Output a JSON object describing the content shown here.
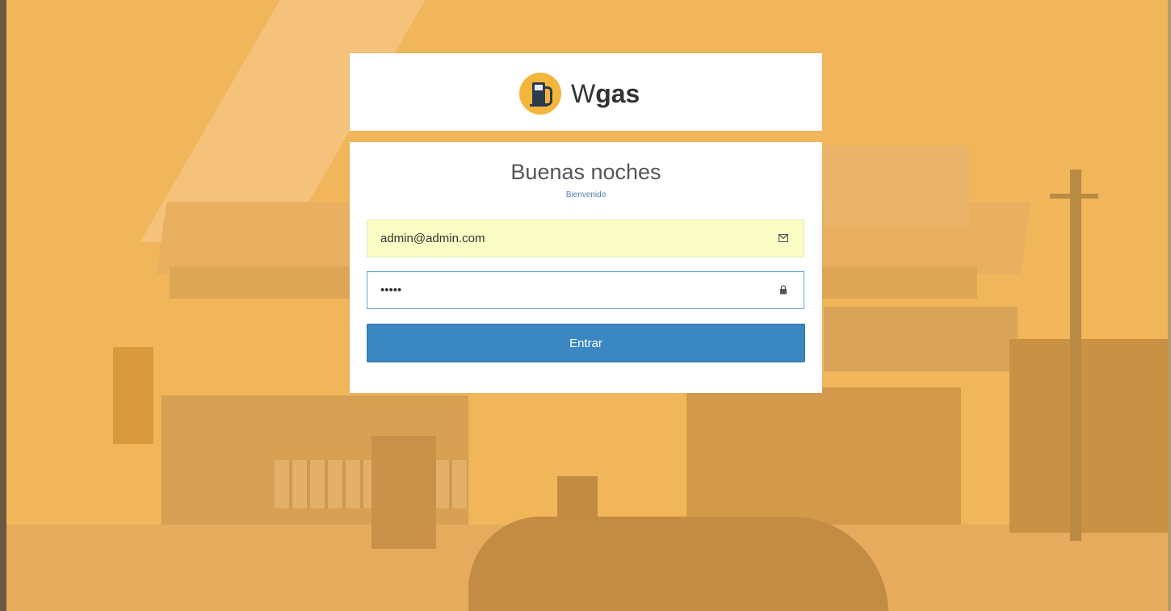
{
  "brand": {
    "name_prefix": "W",
    "name_bold": "gas",
    "logo_icon": "fuel-pump-icon",
    "accent_color": "#f3b63c"
  },
  "login": {
    "greeting": "Buenas noches",
    "subtitle": "Bienvenido",
    "email": {
      "value": "admin@admin.com",
      "icon": "envelope-icon"
    },
    "password": {
      "value": "•••••",
      "icon": "lock-icon"
    },
    "submit_label": "Entrar",
    "button_color": "#3a87c2"
  }
}
